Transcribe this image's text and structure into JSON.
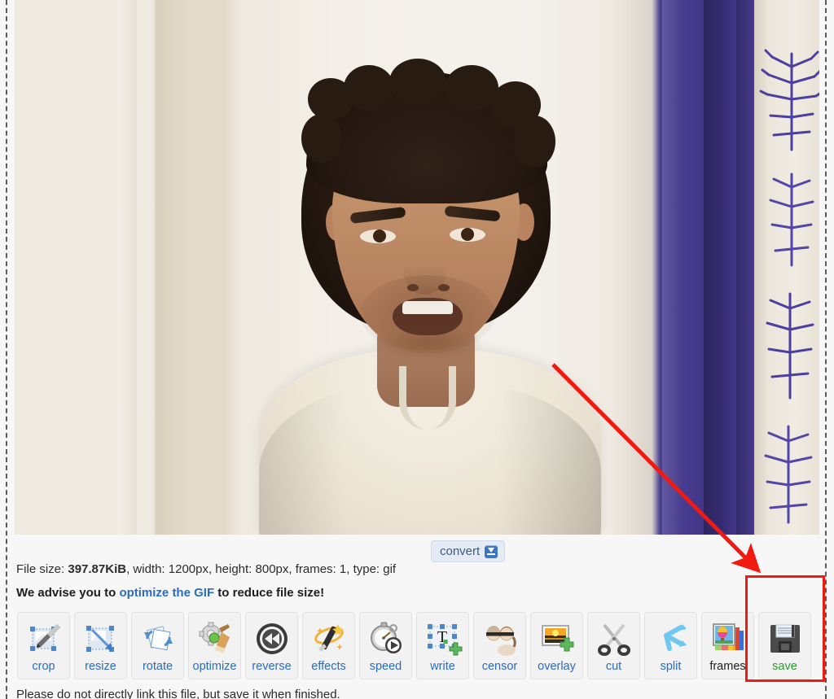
{
  "image": {
    "alt_description": "man with curly dark hair in cream shirt in front of wall and purple curtain",
    "region_name": "gif-preview"
  },
  "convert": {
    "label": "convert",
    "icon": "download-icon"
  },
  "file_info": {
    "prefix": "File size: ",
    "size": "397.87KiB",
    "rest": ", width: 1200px, height: 800px, frames: 1, type: gif",
    "full": "File size: 397.87KiB, width: 1200px, height: 800px, frames: 1, type: gif"
  },
  "advice": {
    "before": "We advise you to ",
    "link": "optimize the GIF",
    "after": " to reduce file size!"
  },
  "footer": {
    "note": "Please do not directly link this file, but save it when finished."
  },
  "toolbar": {
    "items": [
      {
        "label": "crop",
        "icon": "crop-icon"
      },
      {
        "label": "resize",
        "icon": "resize-icon"
      },
      {
        "label": "rotate",
        "icon": "rotate-icon"
      },
      {
        "label": "optimize",
        "icon": "optimize-icon"
      },
      {
        "label": "reverse",
        "icon": "reverse-icon"
      },
      {
        "label": "effects",
        "icon": "effects-icon"
      },
      {
        "label": "speed",
        "icon": "speed-icon"
      },
      {
        "label": "write",
        "icon": "write-icon"
      },
      {
        "label": "censor",
        "icon": "censor-icon"
      },
      {
        "label": "overlay",
        "icon": "overlay-icon"
      },
      {
        "label": "cut",
        "icon": "cut-icon"
      },
      {
        "label": "split",
        "icon": "split-icon"
      },
      {
        "label": "frames",
        "icon": "frames-icon"
      },
      {
        "label": "save",
        "icon": "save-icon"
      }
    ]
  },
  "annotation": {
    "arrow_color": "#f01a10",
    "highlight_color": "#f01a10",
    "target": "save"
  },
  "colors": {
    "link": "#2a6bc4",
    "save_label": "#2e9b2e",
    "curtain": "#453a8e",
    "wall": "#efeae1",
    "page_bg": "#f7f7f7"
  }
}
